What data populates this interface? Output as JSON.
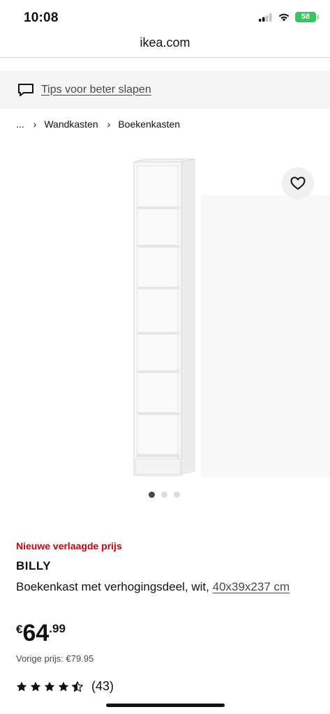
{
  "status_bar": {
    "time": "10:08",
    "battery": "58"
  },
  "browser": {
    "url": "ikea.com"
  },
  "tips_banner": {
    "text": "Tips voor beter slapen",
    "icon": "chat-bubble-icon"
  },
  "breadcrumb": {
    "ellipsis": "...",
    "items": [
      "Wandkasten",
      "Boekenkasten"
    ],
    "separator": "›"
  },
  "gallery": {
    "image_count": 3,
    "active_index": 0,
    "favorite_icon": "heart-icon"
  },
  "product": {
    "price_label": "Nieuwe verlaagde prijs",
    "name": "BILLY",
    "description": "Boekenkast met verhogingsdeel, wit,",
    "dimensions": "40x39x237 cm",
    "price_currency": "€",
    "price_integer": "64",
    "price_decimal": ".99",
    "previous_price": "Vorige prijs: €79.95",
    "rating_value": 4.5,
    "rating_count": "(43)"
  },
  "colors": {
    "accent_red": "#cc0008",
    "text": "#111111",
    "banner_bg": "#f5f5f5"
  }
}
